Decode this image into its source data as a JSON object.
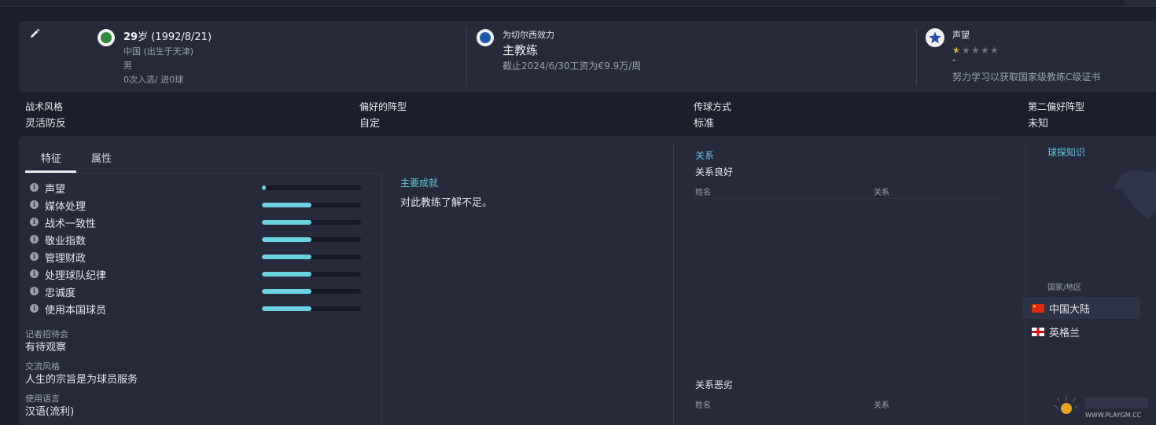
{
  "profile": {
    "age_number": "29",
    "age_suffix": "岁 (1992/8/21)",
    "nationality": "中国 (出生于天津)",
    "gender": "男",
    "caps": "0次入选/ 进0球"
  },
  "club": {
    "header": "为切尔西效力",
    "role": "主教练",
    "contract": "截止2024/6/30工资为€9.9万/周"
  },
  "reputation": {
    "header": "声望",
    "stars": 0.5,
    "max_stars": 5,
    "dash": "-",
    "note": "努力学习以获取国家级教练C级证书"
  },
  "tactics": [
    {
      "label": "战术风格",
      "value": "灵活防反"
    },
    {
      "label": "偏好的阵型",
      "value": "自定"
    },
    {
      "label": "传球方式",
      "value": "标准"
    },
    {
      "label": "第二偏好阵型",
      "value": "未知"
    }
  ],
  "tabs": [
    "特征",
    "属性"
  ],
  "attributes": [
    {
      "label": "声望",
      "level": 0.04
    },
    {
      "label": "媒体处理",
      "level": 0.5
    },
    {
      "label": "战术一致性",
      "level": 0.5
    },
    {
      "label": "敬业指数",
      "level": 0.5
    },
    {
      "label": "管理财政",
      "level": 0.5
    },
    {
      "label": "处理球队纪律",
      "level": 0.5
    },
    {
      "label": "忠诚度",
      "level": 0.5
    },
    {
      "label": "使用本国球员",
      "level": 0.5
    }
  ],
  "info_icon_glyph": "i",
  "press": {
    "label": "记者招待会",
    "value": "有待观察"
  },
  "comm": {
    "label": "交流风格",
    "value": "人生的宗旨是为球员服务"
  },
  "lang": {
    "label": "使用语言",
    "value": "汉语(流利)"
  },
  "achievements": {
    "title": "主要成就",
    "text": "对此教练了解不足。"
  },
  "relations": {
    "title": "关系",
    "good_title": "关系良好",
    "bad_title": "关系恶劣",
    "col_name": "姓名",
    "col_rel": "关系"
  },
  "scout": {
    "title": "球探知识",
    "region_label": "国家/地区",
    "countries": [
      "中国大陆",
      "英格兰"
    ]
  },
  "colors": {
    "accent": "#6dd2e0",
    "title_cyan": "#5ec9da",
    "star": "#f0c419"
  },
  "watermark_text": "WWW.PLAYGM.CC"
}
